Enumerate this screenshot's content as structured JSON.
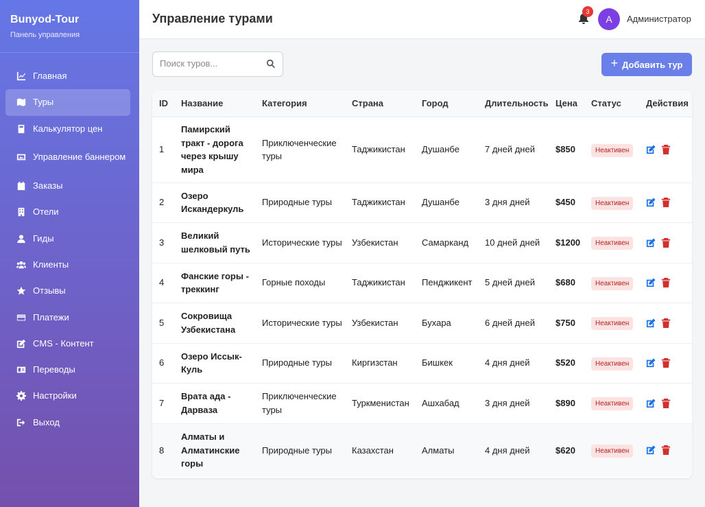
{
  "brand": {
    "title": "Bunyod-Tour",
    "subtitle": "Панель управления"
  },
  "sidebar": {
    "items": [
      {
        "label": "Главная",
        "icon": "chart-line-icon"
      },
      {
        "label": "Туры",
        "icon": "map-icon",
        "active": true
      },
      {
        "label": "Калькулятор цен",
        "icon": "calculator-icon"
      },
      {
        "label": "Управление баннером",
        "icon": "image-icon"
      },
      {
        "label": "Заказы",
        "icon": "calendar-check-icon"
      },
      {
        "label": "Отели",
        "icon": "building-icon"
      },
      {
        "label": "Гиды",
        "icon": "user-icon"
      },
      {
        "label": "Клиенты",
        "icon": "users-icon"
      },
      {
        "label": "Отзывы",
        "icon": "star-icon"
      },
      {
        "label": "Платежи",
        "icon": "credit-card-icon"
      },
      {
        "label": "CMS - Контент",
        "icon": "edit-icon"
      },
      {
        "label": "Переводы",
        "icon": "language-icon"
      },
      {
        "label": "Настройки",
        "icon": "cog-icon"
      },
      {
        "label": "Выход",
        "icon": "sign-out-icon"
      }
    ]
  },
  "header": {
    "title": "Управление турами",
    "notifications": "3",
    "avatar_initial": "A",
    "user": "Администратор"
  },
  "toolbar": {
    "search_placeholder": "Поиск туров...",
    "add_label": "Добавить тур"
  },
  "table": {
    "headers": [
      "ID",
      "Название",
      "Категория",
      "Страна",
      "Город",
      "Длительность",
      "Цена",
      "Статус",
      "Действия"
    ],
    "rows": [
      {
        "id": "1",
        "name": "Памирский тракт - дорога через крышу мира",
        "category": "Приключенческие туры",
        "country": "Таджикистан",
        "city": "Душанбе",
        "duration": "7 дней дней",
        "price": "$850",
        "status": "Неактивен"
      },
      {
        "id": "2",
        "name": "Озеро Искандеркуль",
        "category": "Природные туры",
        "country": "Таджикистан",
        "city": "Душанбе",
        "duration": "3 дня дней",
        "price": "$450",
        "status": "Неактивен"
      },
      {
        "id": "3",
        "name": "Великий шелковый путь",
        "category": "Исторические туры",
        "country": "Узбекистан",
        "city": "Самарканд",
        "duration": "10 дней дней",
        "price": "$1200",
        "status": "Неактивен"
      },
      {
        "id": "4",
        "name": "Фанские горы - треккинг",
        "category": "Горные походы",
        "country": "Таджикистан",
        "city": "Пенджикент",
        "duration": "5 дней дней",
        "price": "$680",
        "status": "Неактивен"
      },
      {
        "id": "5",
        "name": "Сокровища Узбекистана",
        "category": "Исторические туры",
        "country": "Узбекистан",
        "city": "Бухара",
        "duration": "6 дней дней",
        "price": "$750",
        "status": "Неактивен"
      },
      {
        "id": "6",
        "name": "Озеро Иссык-Куль",
        "category": "Природные туры",
        "country": "Киргизстан",
        "city": "Бишкек",
        "duration": "4 дня дней",
        "price": "$520",
        "status": "Неактивен"
      },
      {
        "id": "7",
        "name": "Врата ада - Дарваза",
        "category": "Приключенческие туры",
        "country": "Туркменистан",
        "city": "Ашхабад",
        "duration": "3 дня дней",
        "price": "$890",
        "status": "Неактивен"
      },
      {
        "id": "8",
        "name": "Алматы и Алматинские горы",
        "category": "Природные туры",
        "country": "Казахстан",
        "city": "Алматы",
        "duration": "4 дня дней",
        "price": "$620",
        "status": "Неактивен"
      }
    ]
  },
  "colors": {
    "accent": "#6a80e8",
    "edit_icon": "#1a73e8",
    "delete_icon": "#d32f2f",
    "status_bg": "#fde2e2",
    "status_text": "#b32424"
  }
}
